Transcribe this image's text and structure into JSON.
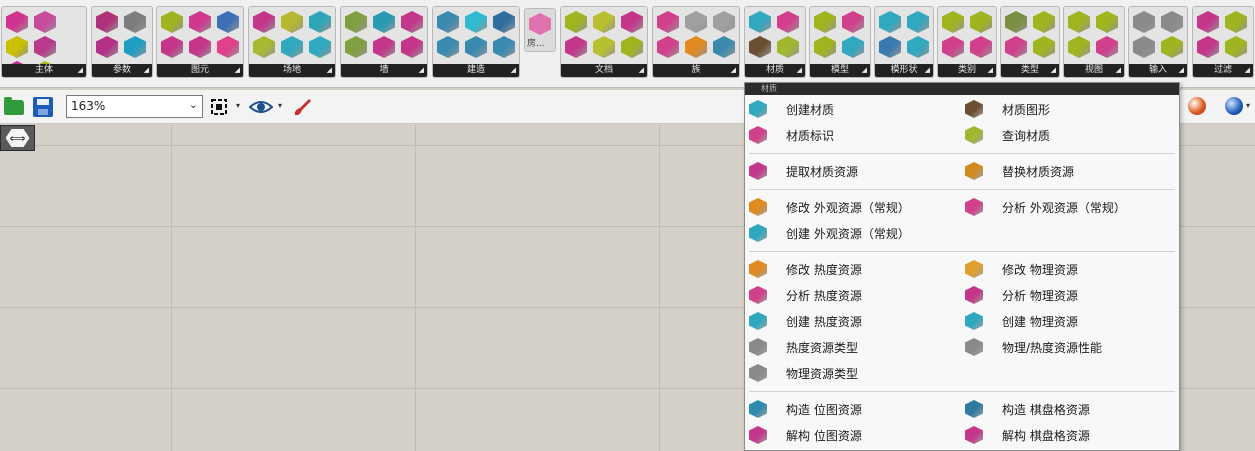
{
  "ribbon": {
    "groups": [
      {
        "label": "主体",
        "colors": [
          "#d0348f",
          "#c84a9a",
          "#c8c000",
          "#b83a8a",
          "#c0308a",
          "#a8b820"
        ]
      },
      {
        "label": "参数",
        "colors": [
          "#b0307a",
          "#7d7d7d",
          "#b42f88",
          "#1f9ec4"
        ]
      },
      {
        "label": "图元",
        "colors": [
          "#a0b420",
          "#d0378f",
          "#3d6fb8",
          "#c4368a",
          "#c4368a",
          "#e0408c"
        ]
      },
      {
        "label": "场地",
        "colors": [
          "#c4368a",
          "#b8b830",
          "#2da6b8",
          "#a8b830",
          "#2fa8c0",
          "#2fa8c0"
        ]
      },
      {
        "label": "墙",
        "colors": [
          "#80a040",
          "#2a9ab0",
          "#c4368a",
          "#80a040",
          "#c4368a",
          "#c4368a"
        ]
      },
      {
        "label": "建造",
        "colors": [
          "#3a8ab0",
          "#2fbad0",
          "#2f6f9f",
          "#3a8ab0",
          "#3a8ab0",
          "#3a8ab0"
        ]
      },
      {
        "label": "文档",
        "colors": [
          "#a0b420",
          "#b8c030",
          "#c4368a",
          "#c4368a",
          "#b8c030",
          "#a0b420"
        ]
      },
      {
        "label": "族",
        "colors": [
          "#d0408c",
          "#a0a0a0",
          "#a0a0a0",
          "#d0408c",
          "#e08a20",
          "#3a8ab0"
        ]
      },
      {
        "label": "材质",
        "colors": [
          "#2fa8c0",
          "#d0408c",
          "#6a5030",
          "#a0b830"
        ]
      },
      {
        "label": "模型",
        "colors": [
          "#a0b420",
          "#d0408c",
          "#a0b420",
          "#2fa8c0"
        ]
      },
      {
        "label": "模形状",
        "colors": [
          "#2fa8c0",
          "#2fa8c0",
          "#3a7ab0",
          "#2fa8c0"
        ]
      },
      {
        "label": "类别",
        "colors": [
          "#a0b420",
          "#a0b420",
          "#d0408c",
          "#d0408c"
        ]
      },
      {
        "label": "类型",
        "colors": [
          "#7a9040",
          "#a0b420",
          "#d0408c",
          "#a0b420"
        ]
      },
      {
        "label": "视图",
        "colors": [
          "#a0b420",
          "#a0b420",
          "#a0b420",
          "#d0408c"
        ]
      },
      {
        "label": "输入",
        "colors": [
          "#8a8a8a",
          "#8a8a8a",
          "#8a8a8a",
          "#a0b420"
        ]
      },
      {
        "label": "过滤",
        "colors": [
          "#c4368a",
          "#a0b420",
          "#c4368a",
          "#a0b420"
        ]
      }
    ],
    "collapsed_label": "房..."
  },
  "toolbar": {
    "zoom_value": "163%",
    "caret": "⌄",
    "dropdown_glyph": "▾"
  },
  "canvas": {
    "pin_glyph": "⟺"
  },
  "panel": {
    "header": "材质",
    "items": [
      {
        "label": "创建材质",
        "color": "#2fa8c0"
      },
      {
        "label": "材质图形",
        "color": "#6a5030"
      },
      {
        "label": "材质标识",
        "color": "#d0408c"
      },
      {
        "label": "查询材质",
        "color": "#a0b830"
      },
      {
        "label": "提取材质资源",
        "color": "#c4368a"
      },
      {
        "label": "替换材质资源",
        "color": "#d08a20"
      },
      {
        "label": "修改 外观资源（常规）",
        "color": "#e08a20"
      },
      {
        "label": "分析 外观资源（常规）",
        "color": "#d0408c"
      },
      {
        "label": "创建 外观资源（常规）",
        "color": "#2fa8c0"
      },
      {
        "label": "修改 热度资源",
        "color": "#e08a20"
      },
      {
        "label": "修改 物理资源",
        "color": "#e0a030"
      },
      {
        "label": "分析 热度资源",
        "color": "#d0408c"
      },
      {
        "label": "分析 物理资源",
        "color": "#c4368a"
      },
      {
        "label": "创建 热度资源",
        "color": "#2fa8c0"
      },
      {
        "label": "创建 物理资源",
        "color": "#2fa8c0"
      },
      {
        "label": "热度资源类型",
        "color": "#8a8a8a"
      },
      {
        "label": "物理/热度资源性能",
        "color": "#8a8a8a"
      },
      {
        "label": "物理资源类型",
        "color": "#8a8a8a"
      },
      {
        "label": "构造 位图资源",
        "color": "#2f8ab0"
      },
      {
        "label": "构造 棋盘格资源",
        "color": "#2f7a9f"
      },
      {
        "label": "解构 位图资源",
        "color": "#c4368a"
      },
      {
        "label": "解构 棋盘格资源",
        "color": "#c4368a"
      }
    ]
  }
}
